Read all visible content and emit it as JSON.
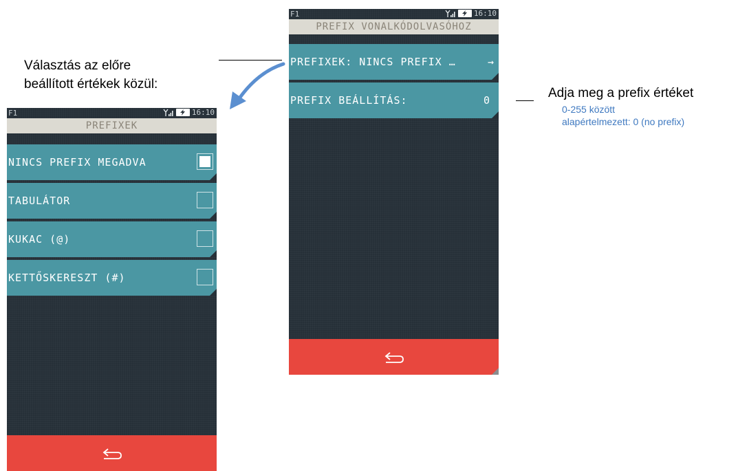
{
  "annotations": {
    "left_caption_line1": "Választás az előre",
    "left_caption_line2": "beállított értékek közül:",
    "right_caption": "Adja meg a prefix értéket",
    "right_detail_line1": "0-255 között",
    "right_detail_line2": "alapértelmezett: 0 (no prefix)"
  },
  "main_screen": {
    "status": {
      "fkey": "F1",
      "time": "16:10"
    },
    "title": "PREFIX VONALKÓDOLVASÓHOZ",
    "rows": [
      {
        "label": "PREFIXEK: NINCS PREFIX …",
        "trail": "→"
      },
      {
        "label": "PREFIX BEÁLLÍTÁS:",
        "value": "0"
      }
    ]
  },
  "list_screen": {
    "status": {
      "fkey": "F1",
      "time": "16:10"
    },
    "title": "PREFIXEK",
    "items": [
      {
        "label": "NINCS PREFIX MEGADVA",
        "checked": true
      },
      {
        "label": "TABULÁTOR",
        "checked": false
      },
      {
        "label": "KUKAC (@)",
        "checked": false
      },
      {
        "label": "KETTŐSKERESZT (#)",
        "checked": false
      }
    ]
  },
  "colors": {
    "row": "#4b97a3",
    "screen_bg": "#263038",
    "title_bg": "#dcdad2",
    "back_bar": "#e8473e",
    "annotation_blue": "#3f79c0",
    "arrow": "#5b8fd0"
  },
  "icons": {
    "status": [
      "signal-icon",
      "battery-charging-icon"
    ],
    "back": "back-arrow-icon",
    "checkbox": "checkbox-icon",
    "chevron": "right-arrow-icon"
  }
}
